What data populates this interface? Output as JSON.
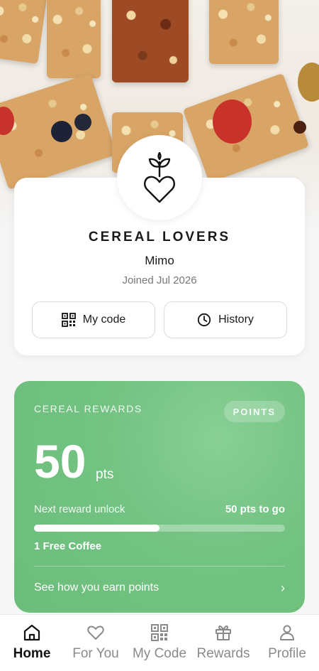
{
  "profile": {
    "brand_name": "CEREAL LOVERS",
    "member_name": "Mimo",
    "joined": "Joined Jul 2026",
    "my_code_label": "My code",
    "history_label": "History"
  },
  "rewards": {
    "title": "CEREAL REWARDS",
    "badge": "POINTS",
    "points": "50",
    "unit": "pts",
    "next_label": "Next reward unlock",
    "to_go": "50 pts to go",
    "progress_fraction": 0.5,
    "reward_name": "1 Free Coffee",
    "earn_link": "See how you earn points"
  },
  "nav": {
    "items": [
      {
        "label": "Home",
        "icon": "home-icon",
        "active": true
      },
      {
        "label": "For You",
        "icon": "heart-icon",
        "active": false
      },
      {
        "label": "My Code",
        "icon": "qr-code-icon",
        "active": false
      },
      {
        "label": "Rewards",
        "icon": "gift-icon",
        "active": false
      },
      {
        "label": "Profile",
        "icon": "user-icon",
        "active": false
      }
    ]
  },
  "colors": {
    "rewards_green": "#72c281",
    "active_nav": "#111111",
    "inactive_nav": "#8a8a8a"
  }
}
